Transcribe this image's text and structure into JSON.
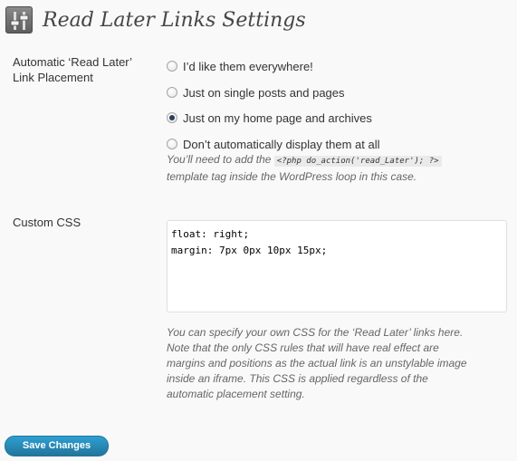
{
  "header": {
    "icon": "settings-sliders-icon",
    "title": "Read Later Links Settings"
  },
  "placement": {
    "label_line1": "Automatic ‘Read Later’",
    "label_line2": "Link Placement",
    "selected": "home",
    "options": [
      {
        "key": "everywhere",
        "label": "I’d like them everywhere!",
        "checked": false
      },
      {
        "key": "single",
        "label": "Just on single posts and pages",
        "checked": false
      },
      {
        "key": "home",
        "label": "Just on my home page and archives",
        "checked": true
      },
      {
        "key": "none",
        "label": "Don’t automatically display them at all",
        "checked": false
      }
    ],
    "help_before": "You’ll need to add the",
    "help_code": "<?php do_action('read_Later'); ?>",
    "help_after": "template tag inside the WordPress loop in this case."
  },
  "custom_css": {
    "label": "Custom CSS",
    "value": "float: right;\nmargin: 7px 0px 10px 15px;",
    "help_lines": [
      "You can specify your own CSS for the ‘Read Later’ links here.",
      "Note that the only CSS rules that will have real effect are",
      "margins and positions as the actual link is an unstylable image",
      "inside an iframe. This CSS is applied regardless of the",
      "automatic placement setting."
    ]
  },
  "actions": {
    "save_label": "Save Changes"
  },
  "colors": {
    "accent": "#21759b",
    "background": "#f9f9f9",
    "help_text": "#666666"
  }
}
